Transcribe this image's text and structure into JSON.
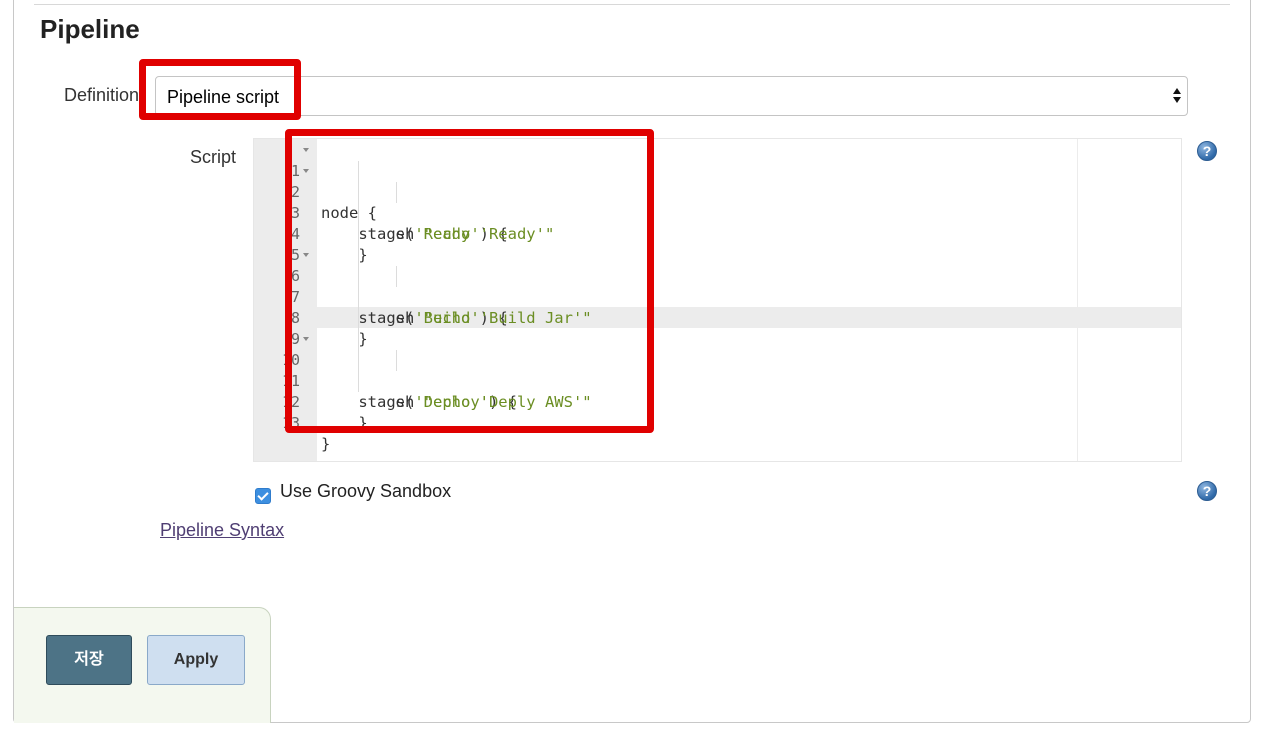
{
  "section": {
    "title": "Pipeline"
  },
  "definition": {
    "label": "Definition",
    "selected": "Pipeline script"
  },
  "script": {
    "label": "Script",
    "lines": [
      {
        "num": "1",
        "fold": true
      },
      {
        "num": "2",
        "fold": true
      },
      {
        "num": "3",
        "fold": false
      },
      {
        "num": "4",
        "fold": false
      },
      {
        "num": "5",
        "fold": false
      },
      {
        "num": "6",
        "fold": true
      },
      {
        "num": "7",
        "fold": false
      },
      {
        "num": "8",
        "fold": false
      },
      {
        "num": "9",
        "fold": false
      },
      {
        "num": "10",
        "fold": true
      },
      {
        "num": "11",
        "fold": false
      },
      {
        "num": "12",
        "fold": false
      },
      {
        "num": "13",
        "fold": false
      }
    ],
    "code": {
      "l1": "node {",
      "l2a": "    stage(",
      "l2b": "'Ready'",
      "l2c": ") {",
      "l3a": "        sh ",
      "l3b": "\"echo 'Ready'\"",
      "l4": "    }",
      "l6a": "    stage(",
      "l6b": "'Build'",
      "l6c": ") {",
      "l7a": "        sh ",
      "l7b": "\"echo 'Build Jar'\"",
      "l8": "    }",
      "l10a": "    stage(",
      "l10b": "'Deploy'",
      "l10c": ") {",
      "l11a": "        sh ",
      "l11b": "\"echo 'Deply AWS'\"",
      "l12": "    }",
      "l13": "}"
    }
  },
  "help_glyph": "?",
  "sandbox": {
    "label": "Use Groovy Sandbox",
    "checked": true
  },
  "syntax_link": "Pipeline Syntax",
  "buttons": {
    "save": "저장",
    "apply": "Apply"
  },
  "colors": {
    "highlight": "#e00000",
    "save_button": "#4d7386",
    "apply_button": "#cfdff0",
    "string": "#6b8e23"
  }
}
